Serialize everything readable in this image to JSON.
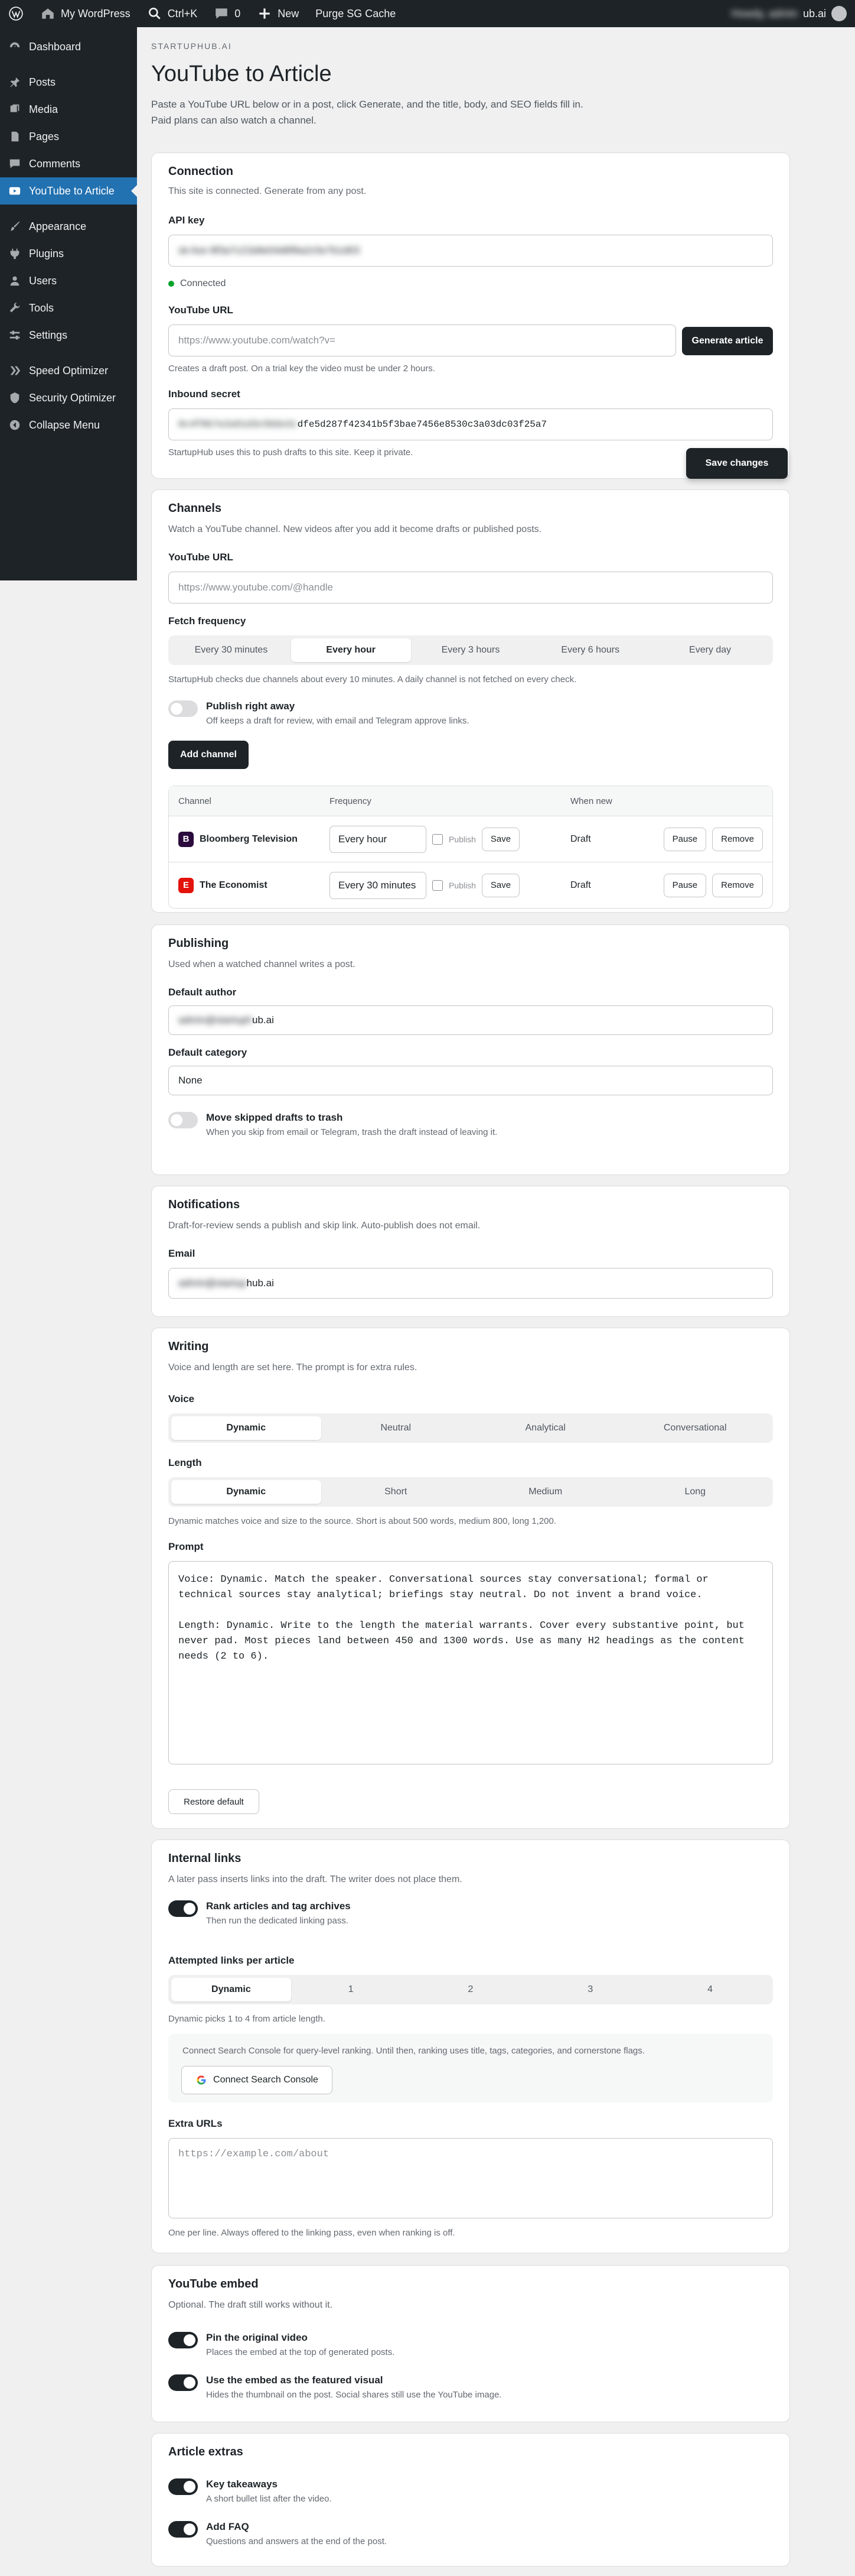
{
  "adminbar": {
    "site": "My WordPress",
    "shortcut": "Ctrl+K",
    "comments": "0",
    "new": "New",
    "purge": "Purge SG Cache",
    "howdy": "Howdy, admin",
    "user_domain_suffix": "ub.ai"
  },
  "sidebar": {
    "items": [
      {
        "label": "Dashboard",
        "icon": "dashboard-icon"
      },
      {
        "label": "Posts",
        "icon": "pin-icon"
      },
      {
        "label": "Media",
        "icon": "media-icon"
      },
      {
        "label": "Pages",
        "icon": "pages-icon"
      },
      {
        "label": "Comments",
        "icon": "comment-icon"
      },
      {
        "label": "YouTube to Article",
        "icon": "youtube-icon",
        "active": true
      },
      {
        "label": "Appearance",
        "icon": "brush-icon"
      },
      {
        "label": "Plugins",
        "icon": "plugin-icon"
      },
      {
        "label": "Users",
        "icon": "users-icon"
      },
      {
        "label": "Tools",
        "icon": "wrench-icon"
      },
      {
        "label": "Settings",
        "icon": "settings-icon"
      },
      {
        "label": "Speed Optimizer",
        "icon": "speed-icon"
      },
      {
        "label": "Security Optimizer",
        "icon": "security-icon"
      },
      {
        "label": "Collapse Menu",
        "icon": "collapse-icon"
      }
    ]
  },
  "page": {
    "eyebrow": "STARTUPHUB.AI",
    "title": "YouTube to Article",
    "lede": "Paste a YouTube URL below or in a post, click Generate, and the title, body, and SEO fields fill in. Paid plans can also watch a channel."
  },
  "connection": {
    "title": "Connection",
    "subtitle": "This site is connected. Generate from any post.",
    "api_key_label": "API key",
    "api_key_value": "sk-live-9f3a7c21b8e04d6f9a2c5e7b1d03",
    "status": "Connected",
    "youtube_url_label": "YouTube URL",
    "youtube_url_placeholder": "https://www.youtube.com/watch?v=",
    "generate_button": "Generate article",
    "youtube_help": "Creates a draft post. On a trial key the video must be under 2 hours.",
    "secret_label": "Inbound secret",
    "secret_prefix": "8c4f0b7e2a91d3c5b6e3c",
    "secret_visible": "dfe5d287f42341b5f3bae7456e8530c3a03dc03f25a7",
    "secret_help": "StartupHub uses this to push drafts to this site. Keep it private.",
    "save_button": "Save changes"
  },
  "channels": {
    "title": "Channels",
    "subtitle": "Watch a YouTube channel. New videos after you add it become drafts or published posts.",
    "url_label": "YouTube URL",
    "url_placeholder": "https://www.youtube.com/@handle",
    "freq_label": "Fetch frequency",
    "freq_options": [
      "Every 30 minutes",
      "Every hour",
      "Every 3 hours",
      "Every 6 hours",
      "Every day"
    ],
    "freq_help": "StartupHub checks due channels about every 10 minutes. A daily channel is not fetched on every check.",
    "publish_label": "Publish right away",
    "publish_desc": "Off keeps a draft for review, with email and Telegram approve links.",
    "add_button": "Add channel",
    "table_headers": [
      "Channel",
      "Frequency",
      "When new"
    ],
    "rows": [
      {
        "name": "Bloomberg Television",
        "logo_letter": "B",
        "logo_color": "#2b0a3d",
        "frequency": "Every hour",
        "publish": "Publish",
        "save": "Save",
        "when_new": "Draft",
        "pause": "Pause",
        "remove": "Remove"
      },
      {
        "name": "The Economist",
        "logo_letter": "E",
        "logo_color": "#e3120b",
        "frequency": "Every 30 minutes",
        "publish": "Publish",
        "save": "Save",
        "when_new": "Draft",
        "pause": "Pause",
        "remove": "Remove"
      }
    ]
  },
  "publishing": {
    "title": "Publishing",
    "subtitle": "Used when a watched channel writes a post.",
    "author_label": "Default author",
    "author_hidden": "admin@startuph",
    "author_visible": "ub.ai",
    "category_label": "Default category",
    "category_value": "None",
    "trash_label": "Move skipped drafts to trash",
    "trash_desc": "When you skip from email or Telegram, trash the draft instead of leaving it."
  },
  "notifications": {
    "title": "Notifications",
    "subtitle": "Draft-for-review sends a publish and skip link. Auto-publish does not email.",
    "email_label": "Email",
    "email_hidden": "admin@startup",
    "email_visible": "hub.ai"
  },
  "writing": {
    "title": "Writing",
    "subtitle": "Voice and length are set here. The prompt is for extra rules.",
    "voice_label": "Voice",
    "voice_options": [
      "Dynamic",
      "Neutral",
      "Analytical",
      "Conversational"
    ],
    "length_label": "Length",
    "length_options": [
      "Dynamic",
      "Short",
      "Medium",
      "Long"
    ],
    "length_help": "Dynamic matches voice and size to the source. Short is about 500 words, medium 800, long 1,200.",
    "prompt_label": "Prompt",
    "prompt_text": "Voice: Dynamic. Match the speaker. Conversational sources stay conversational; formal or technical sources stay analytical; briefings stay neutral. Do not invent a brand voice.\n\nLength: Dynamic. Write to the length the material warrants. Cover every substantive point, but never pad. Most pieces land between 450 and 1300 words. Use as many H2 headings as the content needs (2 to 6).",
    "restore_button": "Restore default"
  },
  "internal_links": {
    "title": "Internal links",
    "subtitle": "A later pass inserts links into the draft. The writer does not place them.",
    "rank_label": "Rank articles and tag archives",
    "rank_desc": "Then run the dedicated linking pass.",
    "attempted_label": "Attempted links per article",
    "attempted_options": [
      "Dynamic",
      "1",
      "2",
      "3",
      "4"
    ],
    "attempted_help": "Dynamic picks 1 to 4 from article length.",
    "gsc_text": "Connect Search Console for query-level ranking. Until then, ranking uses title, tags, categories, and cornerstone flags.",
    "gsc_button": "Connect Search Console",
    "extra_label": "Extra URLs",
    "extra_placeholder": "https://example.com/about",
    "extra_help": "One per line. Always offered to the linking pass, even when ranking is off."
  },
  "embed": {
    "title": "YouTube embed",
    "subtitle": "Optional. The draft still works without it.",
    "pin_label": "Pin the original video",
    "pin_desc": "Places the embed at the top of generated posts.",
    "featured_label": "Use the embed as the featured visual",
    "featured_desc": "Hides the thumbnail on the post. Social shares still use the YouTube image."
  },
  "extras": {
    "title": "Article extras",
    "takeaways_label": "Key takeaways",
    "takeaways_desc": "A short bullet list after the video.",
    "faq_label": "Add FAQ",
    "faq_desc": "Questions and answers at the end of the post."
  }
}
